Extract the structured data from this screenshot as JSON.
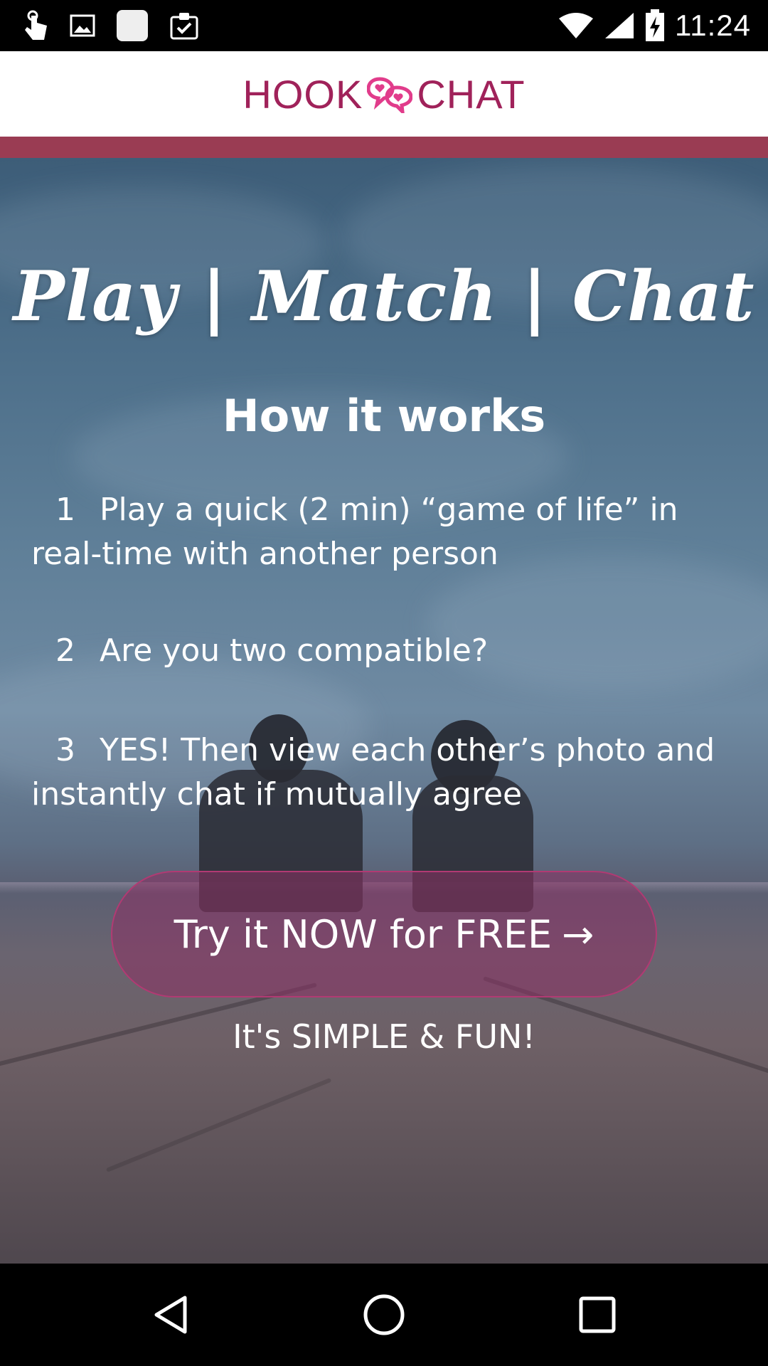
{
  "status_bar": {
    "time": "11:24",
    "left_icons": [
      "touch-icon",
      "image-icon",
      "blank-app-icon",
      "clipboard-check-icon"
    ],
    "right_icons": [
      "wifi-icon",
      "signal-icon",
      "battery-charging-icon"
    ]
  },
  "header": {
    "logo_left": "HOOK",
    "logo_right": "CHAT",
    "logo_icon": "chat-hearts-icon",
    "brand_color": "#a0225a"
  },
  "hero": {
    "tagline": "Play | Match | Chat",
    "how_title": "How it works",
    "steps": [
      {
        "number": "1",
        "text": "Play a quick (2 min) “game of life” in real-time with another person"
      },
      {
        "number": "2",
        "text": "Are you two compatible?"
      },
      {
        "number": "3",
        "text": "YES! Then view each other’s photo and instantly chat if mutually agree"
      }
    ],
    "cta_label": "Try it NOW for FREE",
    "cta_arrow": "→",
    "footer_note": "It's SIMPLE & FUN!"
  },
  "nav": {
    "buttons": [
      "back-icon",
      "home-icon",
      "recents-icon"
    ]
  }
}
